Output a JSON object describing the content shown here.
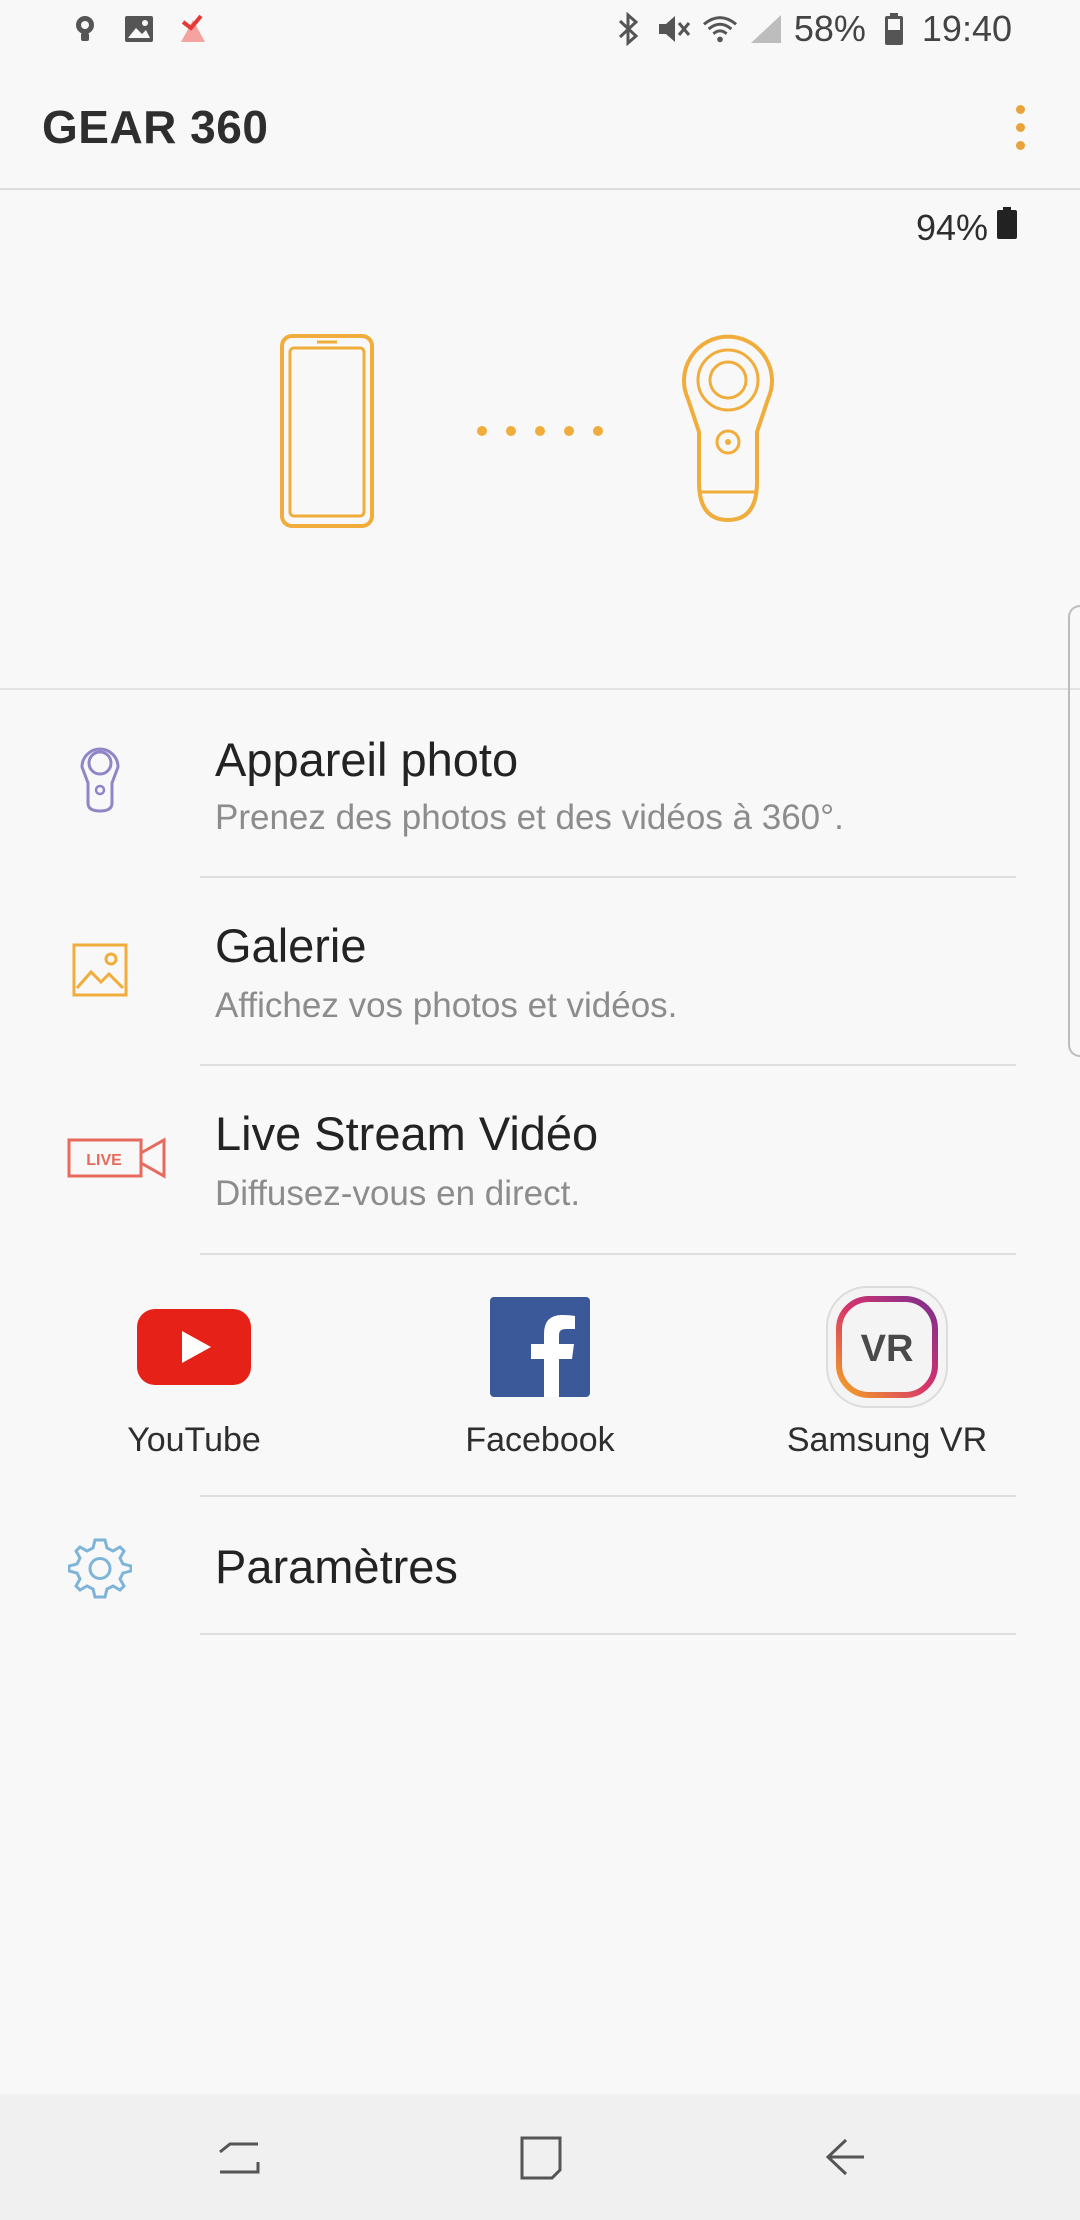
{
  "status_bar": {
    "left_icons": [
      "location-pin-icon",
      "image-icon",
      "notification-app-icon"
    ],
    "right_icons": [
      "bluetooth-icon",
      "mute-icon",
      "wifi-icon",
      "signal-icon"
    ],
    "battery_text": "58%",
    "time": "19:40"
  },
  "app_bar": {
    "title": "GEAR 360",
    "menu_icon": "more-vert-icon"
  },
  "hero": {
    "camera_battery": "94%",
    "accent_color": "#F0AD3C"
  },
  "menu": [
    {
      "icon": "gear360-camera-icon",
      "title": "Appareil photo",
      "subtitle": "Prenez des photos et des vidéos à 360°."
    },
    {
      "icon": "gallery-icon",
      "title": "Galerie",
      "subtitle": "Affichez vos photos et vidéos."
    },
    {
      "icon": "live-camera-icon",
      "title": "Live Stream Vidéo",
      "subtitle": "Diffusez-vous en direct."
    }
  ],
  "share": [
    {
      "icon": "youtube-logo",
      "label": "YouTube"
    },
    {
      "icon": "facebook-logo",
      "label": "Facebook"
    },
    {
      "icon": "samsung-vr-logo",
      "label": "Samsung VR"
    }
  ],
  "settings": {
    "icon": "settings-icon",
    "title": "Paramètres"
  },
  "nav_bar": {
    "buttons": [
      "recent-apps-icon",
      "home-icon",
      "back-icon"
    ]
  }
}
